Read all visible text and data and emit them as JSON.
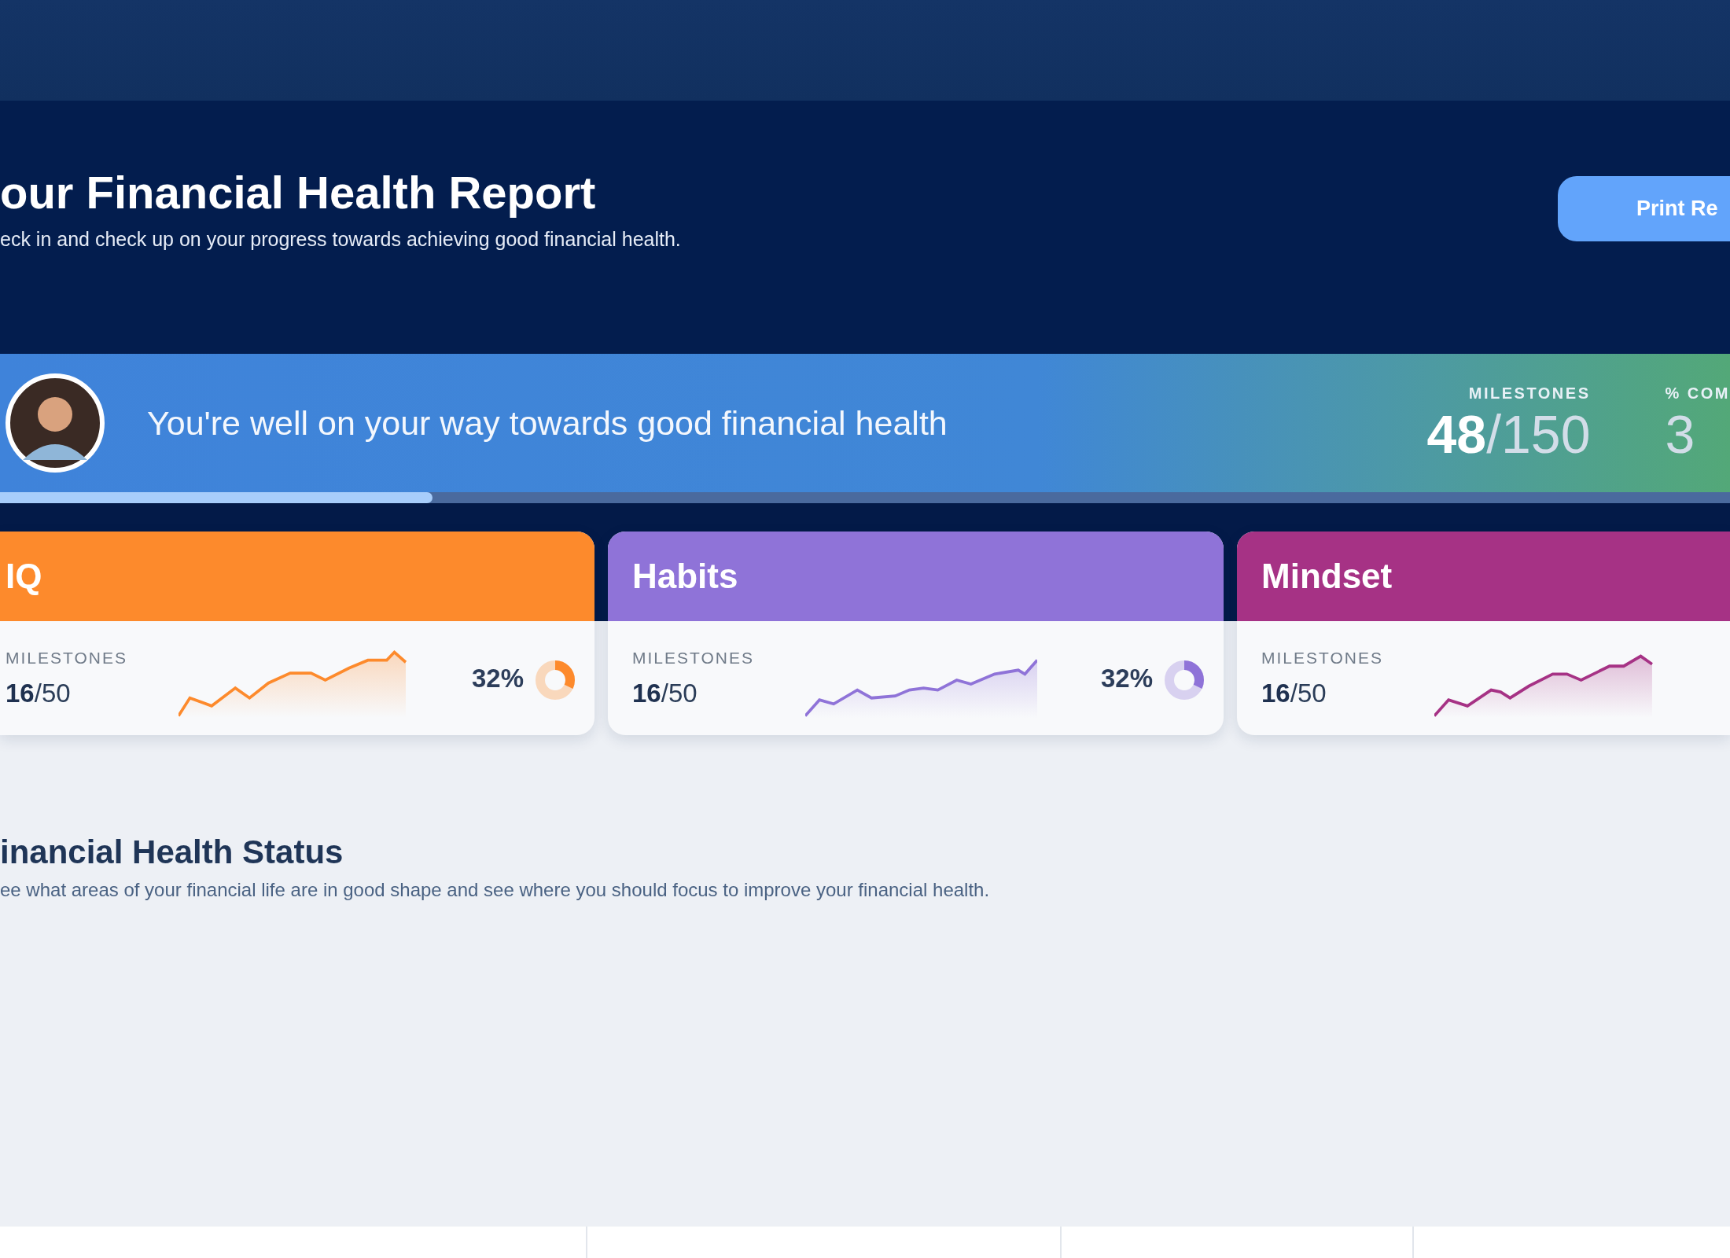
{
  "header": {
    "title": "our Financial Health Report",
    "subtitle": "eck in and check up on your progress towards achieving good financial health.",
    "print_button": "Print Re"
  },
  "banner": {
    "message": "You're well on your way towards good financial health",
    "progress": {
      "level": 0.25
    },
    "stats": [
      {
        "label": "MILESTONES",
        "value": "**48**/150"
      },
      {
        "label": "% COM",
        "value": "3"
      }
    ]
  },
  "categories": [
    {
      "name": "IQ",
      "color": "#fd8a2c",
      "milestones_label": "MILESTONES",
      "milestones": "**16**/50",
      "percent": "32%",
      "level": 0.32
    },
    {
      "name": "Habits",
      "color": "#8f73d8",
      "milestones_label": "MILESTONES",
      "milestones": "**16**/50",
      "percent": "32%",
      "level": 0.32
    },
    {
      "name": "Mindset",
      "color": "#a63285",
      "milestones_label": "MILESTONES",
      "milestones": "**16**/50"
    }
  ],
  "status": {
    "title": "inancial Health Status",
    "subtitle": "ee what areas of your financial life are in good shape and see where you should focus to improve your financial health."
  }
}
